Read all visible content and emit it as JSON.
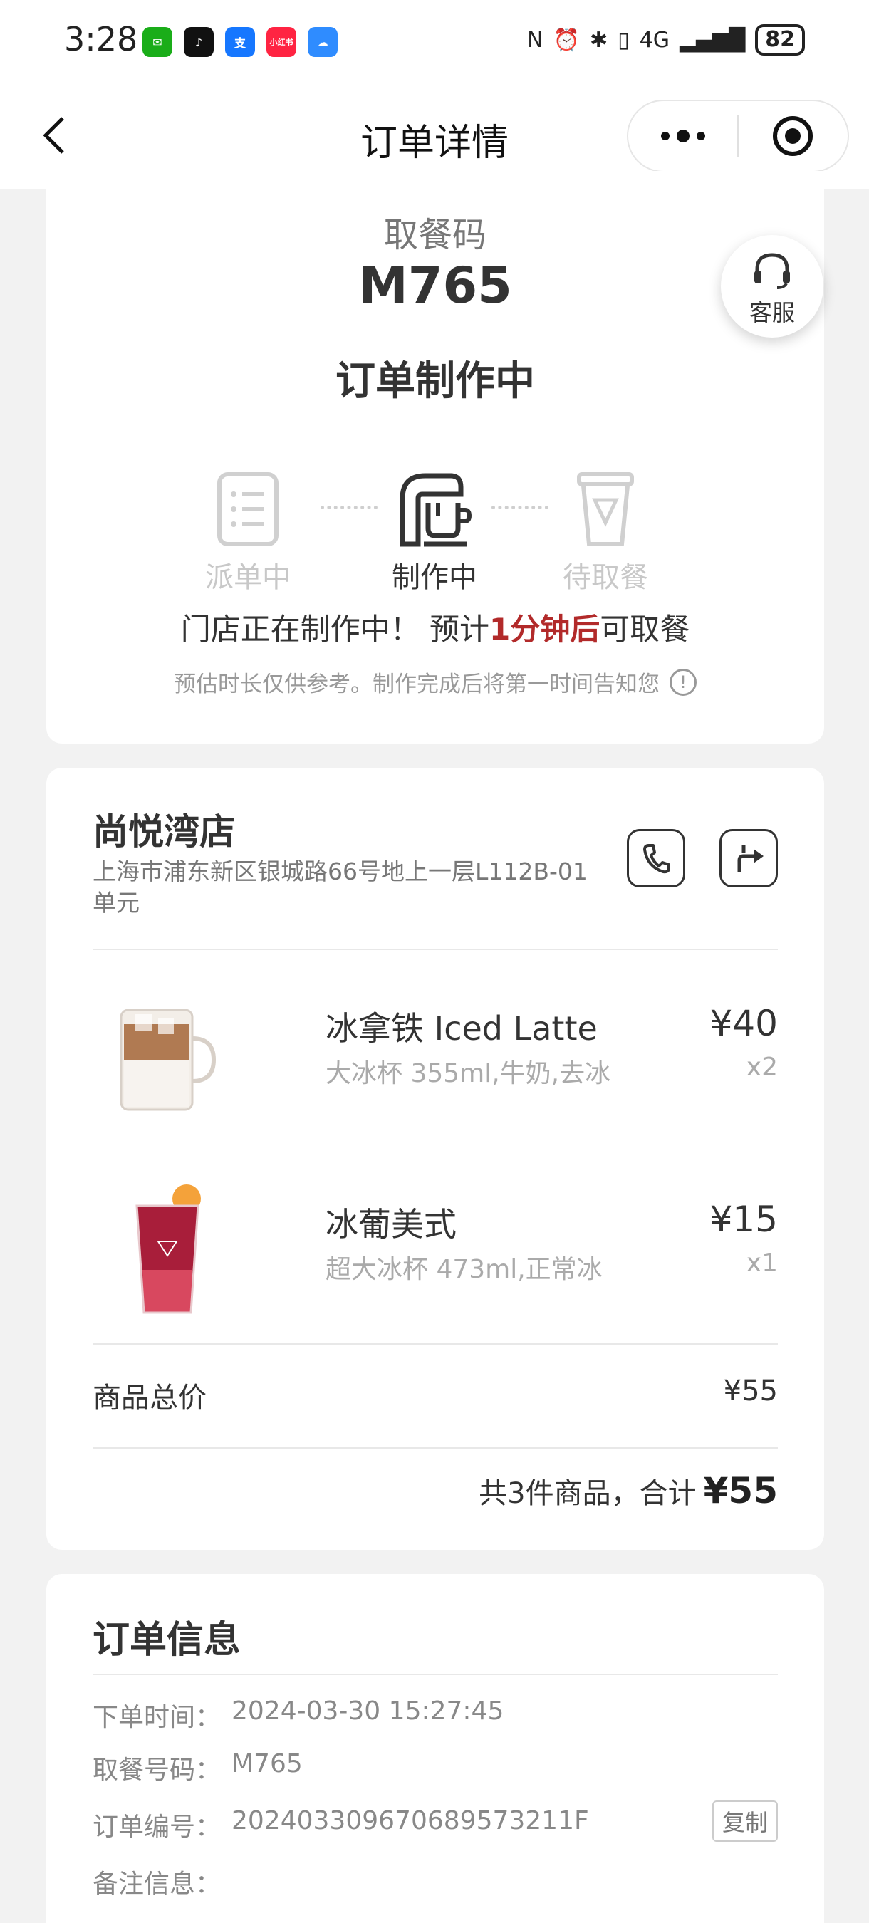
{
  "status_bar": {
    "time": "3:28",
    "apps": [
      {
        "name": "wechat-icon",
        "color": "#1aad19",
        "glyph": "✉"
      },
      {
        "name": "douyin-icon",
        "color": "#111111",
        "glyph": "♪"
      },
      {
        "name": "alipay-icon",
        "color": "#1677ff",
        "glyph": "支"
      },
      {
        "name": "xiaohongshu-icon",
        "color": "#ff2442",
        "glyph": "小红书"
      },
      {
        "name": "weather-icon",
        "color": "#2f8cff",
        "glyph": "☁"
      }
    ],
    "network": "4G",
    "battery": "82"
  },
  "nav": {
    "title": "订单详情"
  },
  "order": {
    "pickup_label": "取餐码",
    "pickup_code": "M765",
    "status_title": "订单制作中",
    "steps": [
      {
        "label": "派单中",
        "state": "inactive"
      },
      {
        "label": "制作中",
        "state": "active"
      },
      {
        "label": "待取餐",
        "state": "inactive"
      }
    ],
    "notice_pre": "门店正在制作中！ 预计",
    "notice_highlight": "1分钟后",
    "notice_post": "可取餐",
    "sub_notice": "预估时长仅供参考。制作完成后将第一时间告知您",
    "info_glyph": "!"
  },
  "service": {
    "label": "客服"
  },
  "store": {
    "name": "尚悦湾店",
    "address": "上海市浦东新区银城路66号地上一层L112B-01单元",
    "items": [
      {
        "name": "冰拿铁 Iced Latte",
        "spec": "大冰杯 355ml,牛奶,去冰",
        "price": "¥40",
        "qty": "x2"
      },
      {
        "name": "冰葡美式",
        "spec": "超大冰杯 473ml,正常冰",
        "price": "¥15",
        "qty": "x1"
      }
    ],
    "subtotal_label": "商品总价",
    "subtotal_value": "¥55",
    "total_prefix": "共3件商品，合计",
    "total_amount": "¥55"
  },
  "info": {
    "title": "订单信息",
    "rows": [
      {
        "key": "下单时间：",
        "value": "2024-03-30 15:27:45"
      },
      {
        "key": "取餐号码：",
        "value": "M765"
      },
      {
        "key": "订单编号：",
        "value": "20240330967068957321​1F"
      },
      {
        "key": "备注信息：",
        "value": ""
      }
    ],
    "copy_label": "复制"
  },
  "colors": {
    "highlight": "#b22a2a",
    "page_bg": "#f2f2f2"
  }
}
